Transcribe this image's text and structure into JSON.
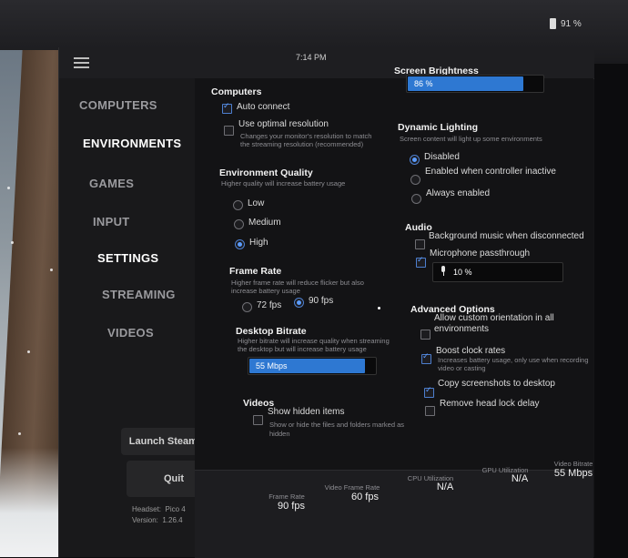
{
  "status": {
    "battery": "91 %",
    "time": "7:14 PM"
  },
  "nav": [
    "COMPUTERS",
    "ENVIRONMENTS",
    "GAMES",
    "INPUT",
    "SETTINGS",
    "STREAMING",
    "VIDEOS"
  ],
  "nav_active": "SETTINGS",
  "sidebar_buttons": {
    "launch": "Launch SteamVR",
    "quit": "Quit"
  },
  "version_info": {
    "headset_label": "Headset:",
    "headset": "Pico 4",
    "version_label": "Version:",
    "version": "1.26.4"
  },
  "settings": {
    "computers": {
      "title": "Computers",
      "auto_connect": {
        "label": "Auto connect",
        "checked": true
      },
      "optimal_resolution": {
        "label": "Use optimal resolution",
        "desc1": "Changes your monitor's resolution to match",
        "desc2": "the streaming resolution (recommended)",
        "checked": false
      }
    },
    "environment_quality": {
      "title": "Environment Quality",
      "desc": "Higher quality will increase battery usage",
      "options": [
        "Low",
        "Medium",
        "High"
      ],
      "selected": "High"
    },
    "frame_rate": {
      "title": "Frame Rate",
      "desc1": "Higher frame rate will reduce flicker but also",
      "desc2": "increase battery usage",
      "options": [
        "72 fps",
        "90 fps"
      ],
      "selected": "90 fps"
    },
    "desktop_bitrate": {
      "title": "Desktop Bitrate",
      "desc1": "Higher bitrate will increase quality when streaming",
      "desc2": "the desktop but will increase battery usage",
      "value": "55 Mbps",
      "fill_percent": 92
    },
    "videos": {
      "title": "Videos",
      "show_hidden": {
        "label": "Show hidden items",
        "desc1": "Show or hide the files and folders marked as",
        "desc2": "hidden",
        "checked": false
      }
    },
    "screen_brightness": {
      "title": "Screen Brightness",
      "value": "86 %",
      "fill_percent": 86
    },
    "dynamic_lighting": {
      "title": "Dynamic Lighting",
      "desc": "Screen content will light up some environments",
      "options": [
        "Disabled",
        "Enabled when controller inactive",
        "Always enabled"
      ],
      "selected": "Disabled"
    },
    "audio": {
      "title": "Audio",
      "background_music": {
        "label": "Background music when disconnected",
        "checked": false
      },
      "mic_passthrough": {
        "label": "Microphone passthrough",
        "checked": true
      },
      "mic_volume": {
        "value": "10 %",
        "icon": "microphone-icon"
      }
    },
    "advanced": {
      "title": "Advanced Options",
      "custom_orientation": {
        "label1": "Allow custom orientation in all",
        "label2": "environments",
        "checked": false
      },
      "boost_clock": {
        "label": "Boost clock rates",
        "desc1": "Increases battery usage, only use when recording",
        "desc2": "video or casting",
        "checked": true
      },
      "copy_screenshots": {
        "label": "Copy screenshots to desktop",
        "checked": true
      },
      "remove_head_lock": {
        "label": "Remove head lock delay",
        "checked": false
      }
    }
  },
  "stats": [
    {
      "label": "Frame Rate",
      "value": "90 fps"
    },
    {
      "label": "Video Frame Rate",
      "value": "60 fps"
    },
    {
      "label": "CPU Utilization",
      "value": "N/A"
    },
    {
      "label": "GPU Utilization",
      "value": "N/A"
    },
    {
      "label": "Video Bitrate",
      "value": "55 Mbps"
    }
  ],
  "colors": {
    "accent": "#2e78d2",
    "check": "#5b9cff",
    "background": "#131315"
  }
}
